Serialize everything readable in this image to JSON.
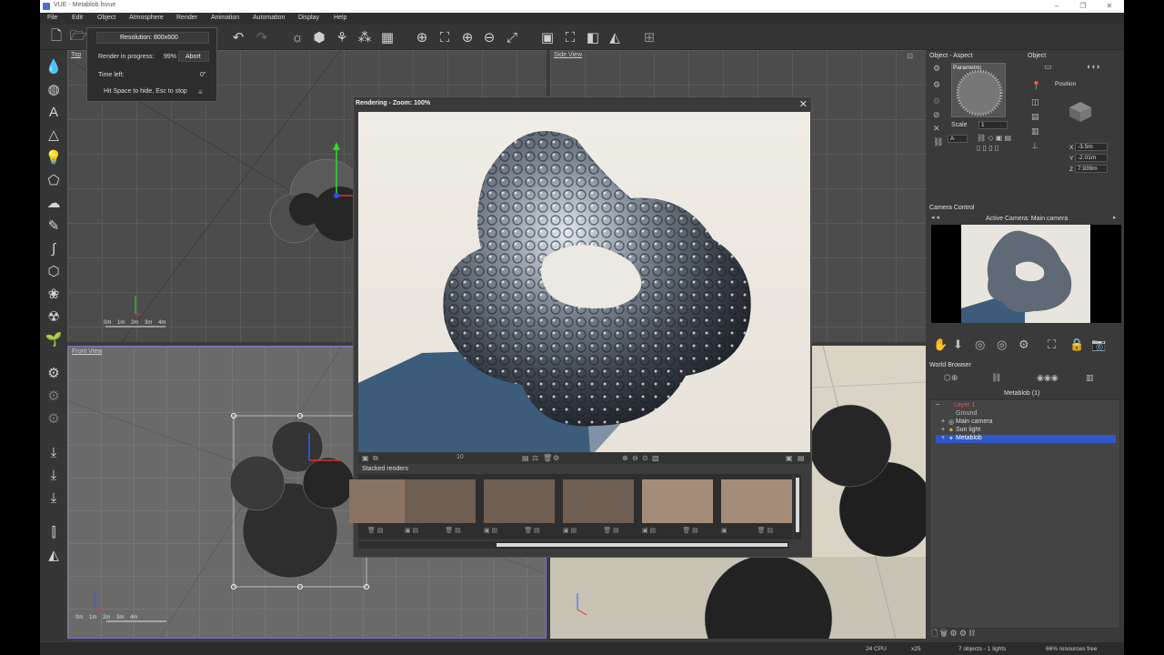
{
  "window": {
    "title": "VUE - Metablob.fsvue",
    "minimize": "–",
    "maximize": "❐",
    "close": "✕"
  },
  "menu": [
    "File",
    "Edit",
    "Object",
    "Atmosphere",
    "Render",
    "Animation",
    "Automation",
    "Display",
    "Help"
  ],
  "viewports": {
    "top": {
      "label": "Top"
    },
    "side": {
      "label": "Side View"
    },
    "front": {
      "label": "Front View"
    },
    "scale_ticks": [
      "0m",
      "1m",
      "2m",
      "3m",
      "4m"
    ]
  },
  "render_progress": {
    "resolution": "Resolution: 800x600",
    "progress_label": "Render in progress:",
    "progress_value": "99%",
    "progress_fraction": 0.99,
    "abort_label": "Abort",
    "time_left_label": "Time left:",
    "time_left_value": "0\"",
    "hint": "Hit Space to hide, Esc to stop"
  },
  "render_window": {
    "title": "Rendering - Zoom: 100%",
    "close": "✕",
    "frame_value": "10",
    "stacked_label": "Stacked renders"
  },
  "object_aspect": {
    "title": "Object - Aspect",
    "material_label": "Parametric",
    "scale_label": "Scale",
    "scale_value": "1",
    "mapping_value": "A"
  },
  "object_panel": {
    "title": "Object",
    "position_label": "Position",
    "x_label": "X",
    "x_value": "-3.5m",
    "y_label": "Y",
    "y_value": "-2.01m",
    "z_label": "Z",
    "z_value": "7.939m"
  },
  "camera_control": {
    "title": "Camera Control",
    "active_camera": "Active Camera: Main camera"
  },
  "world_browser": {
    "title": "World Browser",
    "selected": "Metablob (1)",
    "items": [
      {
        "label": "Layer 1",
        "expander": "−",
        "icon": "",
        "color": "#e05555"
      },
      {
        "label": "Ground",
        "expander": "",
        "icon": "",
        "color": "#bbbbbb"
      },
      {
        "label": "Main camera",
        "expander": "+",
        "icon": "◎",
        "color": "#dddddd"
      },
      {
        "label": "Sun light",
        "expander": "+",
        "icon": "✷",
        "color": "#dddddd"
      },
      {
        "label": "Metablob",
        "expander": "+",
        "icon": "✦",
        "color": "#ffffff"
      }
    ]
  },
  "status": {
    "cpu": "24 CPU",
    "zoom": "x25",
    "objects": "7 objects - 1 lights",
    "resources": "66% resources free"
  }
}
